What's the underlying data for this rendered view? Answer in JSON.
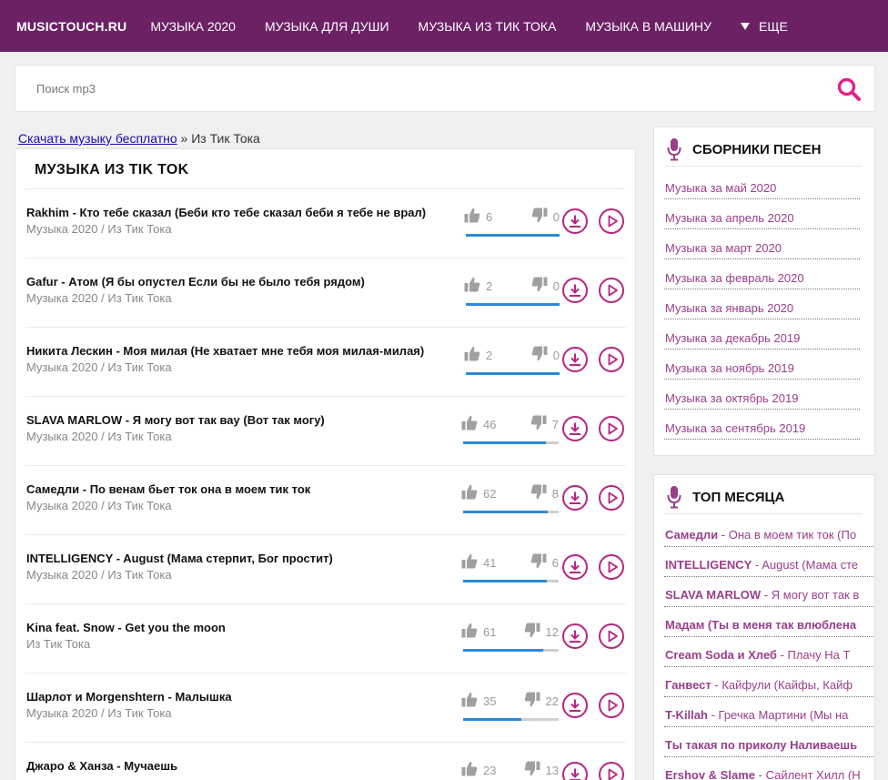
{
  "header": {
    "logo": "MUSICTOUCH.RU",
    "nav": [
      "МУЗЫКА 2020",
      "МУЗЫКА ДЛЯ ДУШИ",
      "МУЗЫКА ИЗ ТИК ТОКА",
      "МУЗЫКА В МАШИНУ"
    ],
    "more_label": "ЕЩЕ"
  },
  "search": {
    "placeholder": "Поиск mp3"
  },
  "breadcrumb": {
    "link": "Скачать музыку бесплатно",
    "separator": "»",
    "current": "Из Тик Тока"
  },
  "main": {
    "title": "МУЗЫКА ИЗ TIK TOK",
    "tracks": [
      {
        "artist": "Rakhim",
        "song": "Кто тебе сказал (Беби кто тебе сказал беби я тебе не врал)",
        "category": "Музыка 2020 / Из Тик Тока",
        "likes": 6,
        "dislikes": 0
      },
      {
        "artist": "Gafur",
        "song": "Атом (Я бы опустел Если бы не было тебя рядом)",
        "category": "Музыка 2020 / Из Тик Тока",
        "likes": 2,
        "dislikes": 0
      },
      {
        "artist": "Никита Лескин",
        "song": "Моя милая (Не хватает мне тебя моя милая-милая)",
        "category": "Музыка 2020 / Из Тик Тока",
        "likes": 2,
        "dislikes": 0
      },
      {
        "artist": "SLAVA MARLOW",
        "song": "Я могу вот так вау (Вот так могу)",
        "category": "Музыка 2020 / Из Тик Тока",
        "likes": 46,
        "dislikes": 7
      },
      {
        "artist": "Самедли",
        "song": "По венам бьет ток она в моем тик ток",
        "category": "Музыка 2020 / Из Тик Тока",
        "likes": 62,
        "dislikes": 8
      },
      {
        "artist": "INTELLIGENCY",
        "song": "August (Мама стерпит, Бог простит)",
        "category": "Музыка 2020 / Из Тик Тока",
        "likes": 41,
        "dislikes": 6
      },
      {
        "artist": "Kina feat. Snow",
        "song": "Get you the moon",
        "category": "Из Тик Тока",
        "likes": 61,
        "dislikes": 12
      },
      {
        "artist": "Шарлот и Morgenshtern",
        "song": "Малышка",
        "category": "Музыка 2020 / Из Тик Тока",
        "likes": 35,
        "dislikes": 22
      },
      {
        "artist": "Джаро & Ханза",
        "song": "Мучаешь",
        "category": "",
        "likes": 23,
        "dislikes": 13
      }
    ]
  },
  "sidebar": {
    "collections_title": "СБОРНИКИ ПЕСЕН",
    "collections": [
      "Музыка за май 2020",
      "Музыка за апрель 2020",
      "Музыка за март 2020",
      "Музыка за февраль 2020",
      "Музыка за январь 2020",
      "Музыка за декабрь 2019",
      "Музыка за ноябрь 2019",
      "Музыка за октябрь 2019",
      "Музыка за сентябрь 2019"
    ],
    "top_title": "ТОП МЕСЯЦА",
    "top": [
      {
        "artist": "Самедли",
        "song": "Она в моем тик ток (По"
      },
      {
        "artist": "INTELLIGENCY",
        "song": "August (Мама сте"
      },
      {
        "artist": "SLAVA MARLOW",
        "song": "Я могу вот так в"
      },
      {
        "artist": "Мадам (Ты в меня так влюблена",
        "song": ""
      },
      {
        "artist": "Cream Soda и Хлеб",
        "song": "Плачу На Т"
      },
      {
        "artist": "Ганвест",
        "song": "Кайфули (Кайфы, Кайф"
      },
      {
        "artist": "T-Killah",
        "song": "Гречка Мартини (Мы на"
      },
      {
        "artist": "Ты такая по приколу Наливаешь",
        "song": ""
      },
      {
        "artist": "Ershov & Slame",
        "song": "Сайлент Хилл (Н"
      }
    ]
  },
  "colors": {
    "header_bg": "#6b2164",
    "accent": "#b8257e",
    "link": "#9a3e8c",
    "rating_bar": "#2b8ad8"
  },
  "icons": [
    "search-icon",
    "like-icon",
    "dislike-icon",
    "download-icon",
    "play-icon",
    "microphone-icon",
    "dropdown-triangle-icon"
  ]
}
